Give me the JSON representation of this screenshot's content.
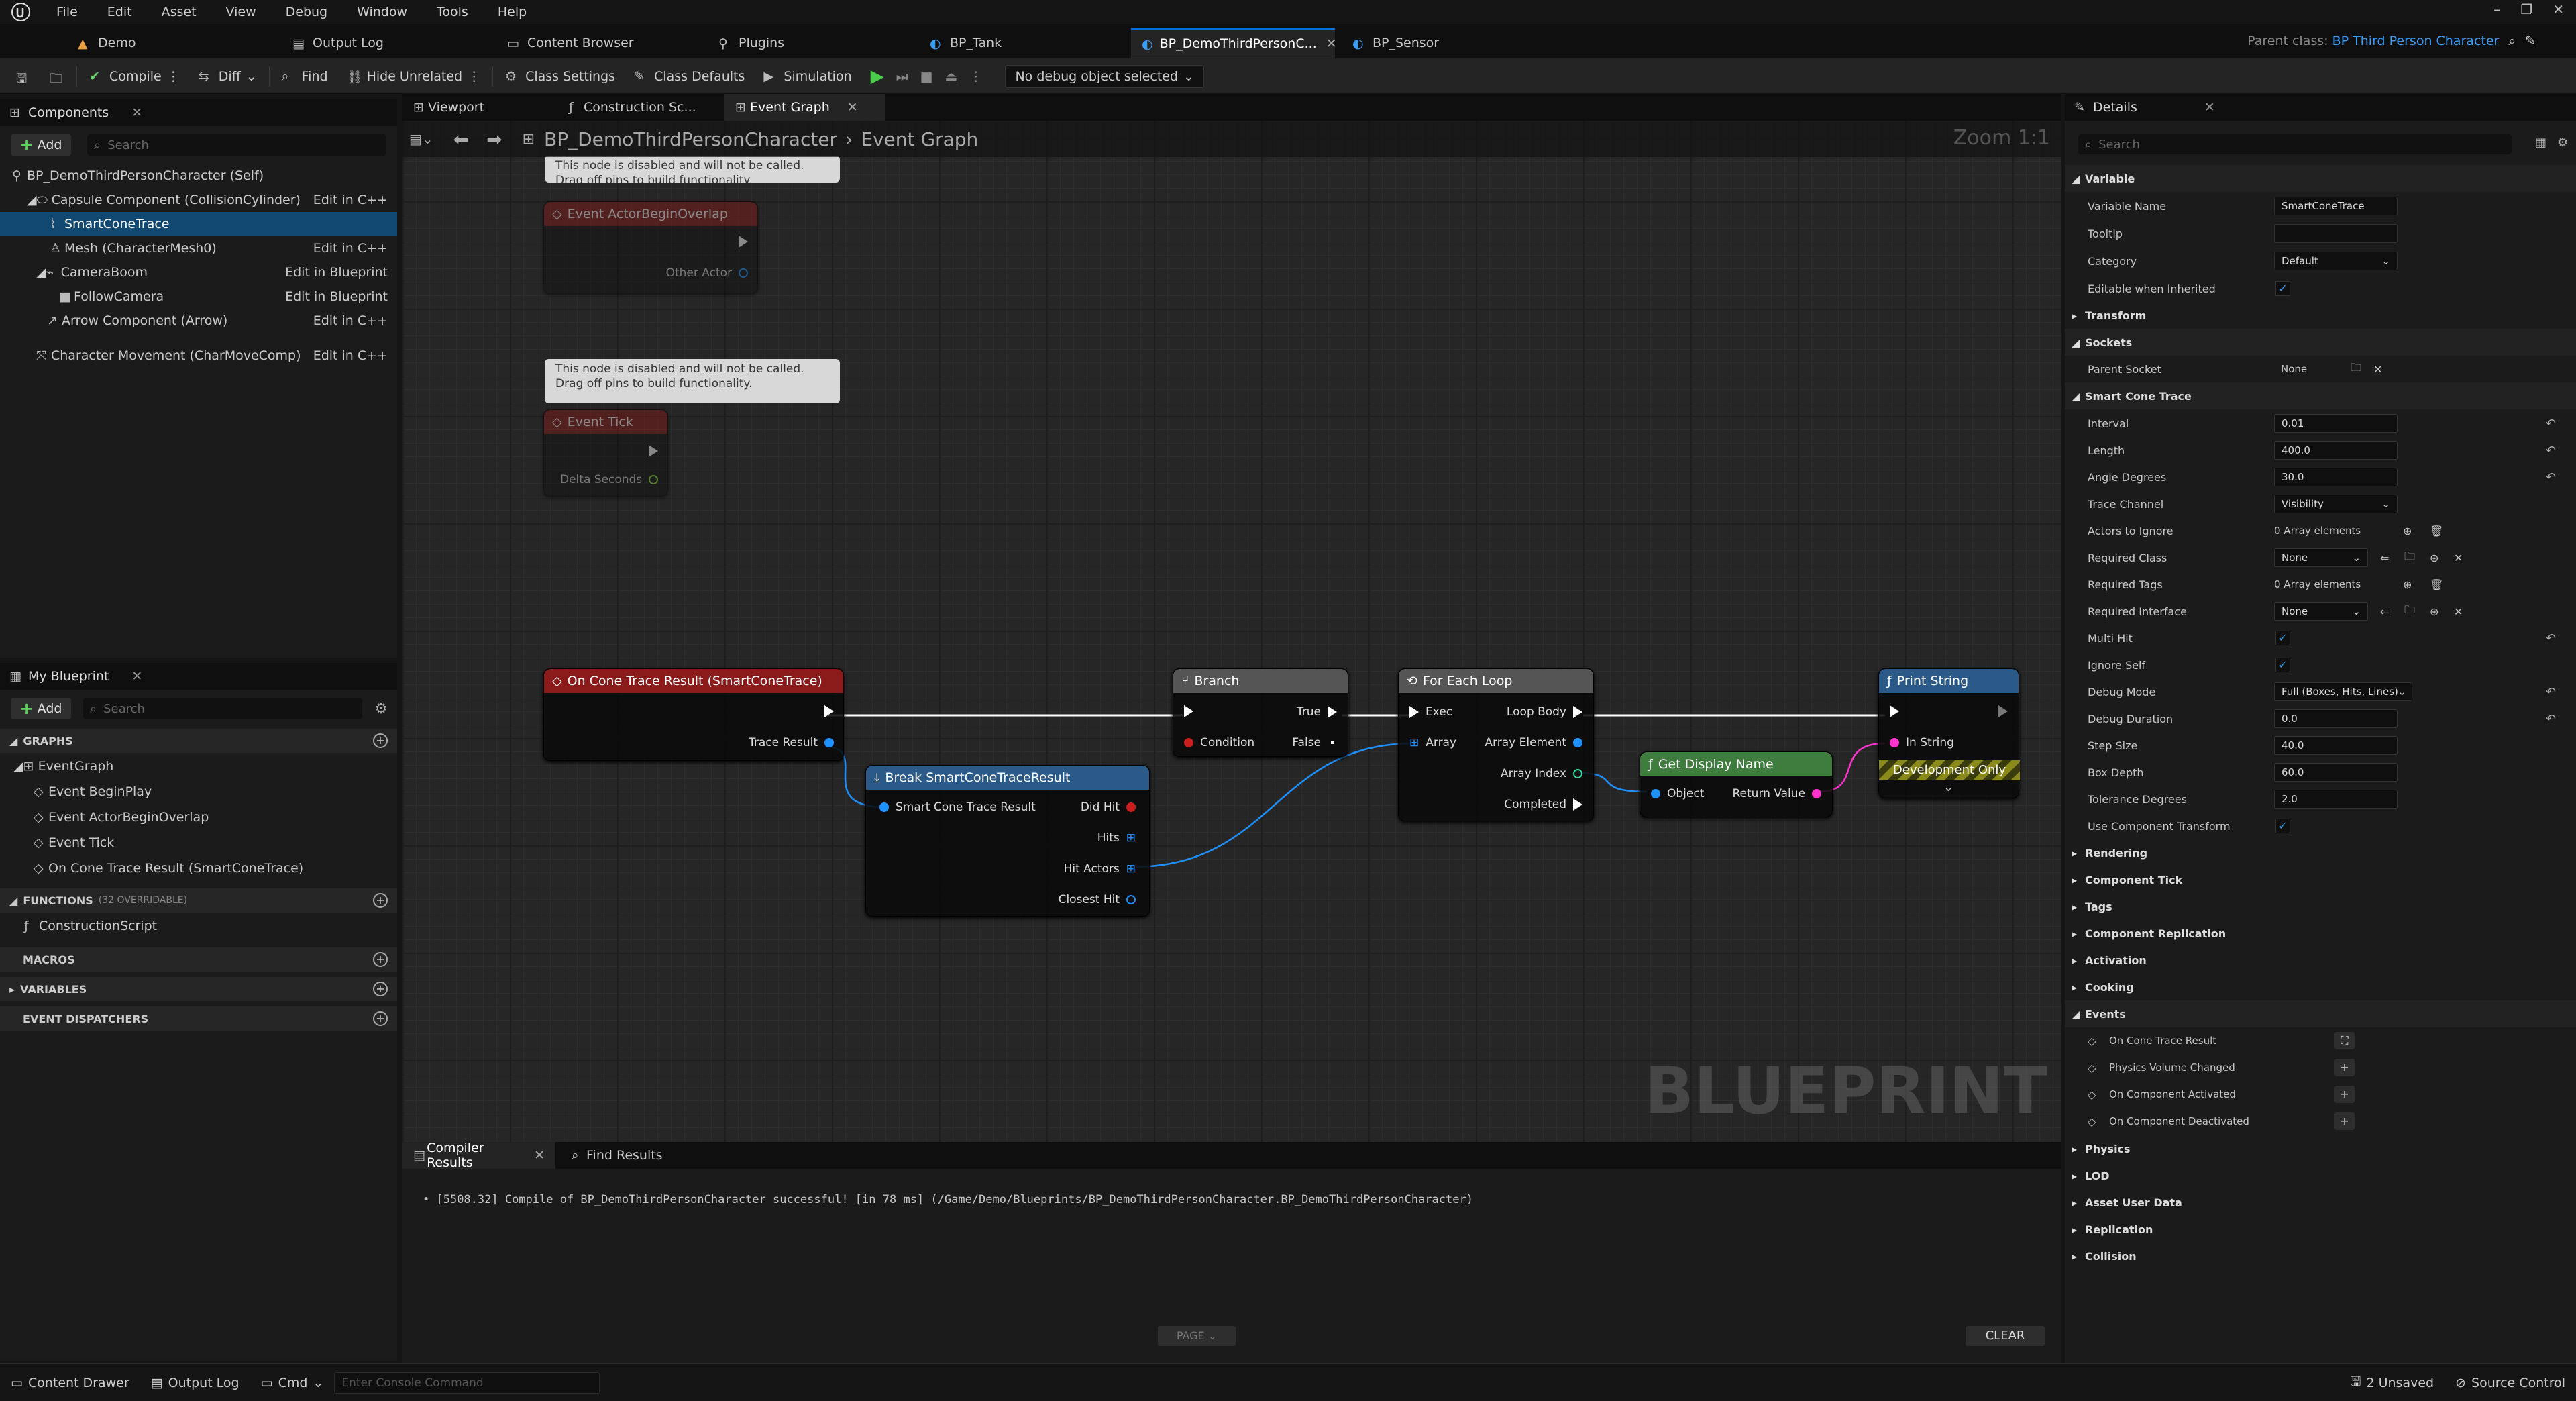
{
  "menubar": {
    "items": [
      "File",
      "Edit",
      "Asset",
      "View",
      "Debug",
      "Window",
      "Tools",
      "Help"
    ]
  },
  "tabs": {
    "items": [
      "Demo",
      "Output Log",
      "Content Browser",
      "Plugins",
      "BP_Tank",
      "BP_DemoThirdPersonC...",
      "BP_Sensor"
    ]
  },
  "parent_class": {
    "label": "Parent class:",
    "value": "BP Third Person Character"
  },
  "toolbar": {
    "compile": "Compile",
    "diff": "Diff",
    "find": "Find",
    "hide_unrelated": "Hide Unrelated",
    "class_settings": "Class Settings",
    "class_defaults": "Class Defaults",
    "simulation": "Simulation",
    "debug_object": "No debug object selected"
  },
  "components": {
    "tab": "Components",
    "add": "Add",
    "search_placeholder": "Search",
    "items": [
      {
        "label": "BP_DemoThirdPersonCharacter (Self)",
        "link": ""
      },
      {
        "label": "Capsule Component (CollisionCylinder)",
        "link": "Edit in C++"
      },
      {
        "label": "SmartConeTrace",
        "link": ""
      },
      {
        "label": "Mesh (CharacterMesh0)",
        "link": "Edit in C++"
      },
      {
        "label": "CameraBoom",
        "link": "Edit in Blueprint"
      },
      {
        "label": "FollowCamera",
        "link": "Edit in Blueprint"
      },
      {
        "label": "Arrow Component (Arrow)",
        "link": "Edit in C++"
      },
      {
        "label": "Character Movement (CharMoveComp)",
        "link": "Edit in C++"
      }
    ]
  },
  "my_blueprint": {
    "tab": "My Blueprint",
    "add": "Add",
    "search_placeholder": "Search",
    "graphs": "GRAPHS",
    "graph_items": [
      "EventGraph",
      "Event BeginPlay",
      "Event ActorBeginOverlap",
      "Event Tick",
      "On Cone Trace Result (SmartConeTrace)"
    ],
    "functions": "FUNCTIONS",
    "functions_count": "(32 OVERRIDABLE)",
    "function_items": [
      "ConstructionScript"
    ],
    "macros": "MACROS",
    "variables": "VARIABLES",
    "dispatchers": "EVENT DISPATCHERS"
  },
  "graph": {
    "tabs": [
      "Viewport",
      "Construction Sc...",
      "Event Graph"
    ],
    "breadcrumb_root": "BP_DemoThirdPersonCharacter",
    "breadcrumb_leaf": "Event Graph",
    "zoom": "Zoom 1:1",
    "watermark": "BLUEPRINT",
    "disabled_comment_1": "This node is disabled and will not be called.",
    "disabled_comment_2": "Drag off pins to build functionality.",
    "nodes": {
      "overlap": {
        "title": "Event ActorBeginOverlap",
        "pin": "Other Actor"
      },
      "tick": {
        "title": "Event Tick",
        "pin": "Delta Seconds"
      },
      "cone": {
        "title": "On Cone Trace Result (SmartConeTrace)",
        "pin": "Trace Result"
      },
      "break": {
        "title": "Break SmartConeTraceResult",
        "in": "Smart Cone Trace Result",
        "out": [
          "Did Hit",
          "Hits",
          "Hit Actors",
          "Closest Hit"
        ]
      },
      "branch": {
        "title": "Branch",
        "in": "Condition",
        "true": "True",
        "false": "False"
      },
      "foreach": {
        "title": "For Each Loop",
        "exec": "Exec",
        "array": "Array",
        "loop_body": "Loop Body",
        "element": "Array Element",
        "index": "Array Index",
        "completed": "Completed"
      },
      "display": {
        "title": "Get Display Name",
        "in": "Object",
        "out": "Return Value"
      },
      "print": {
        "title": "Print String",
        "in": "In String",
        "dev": "Development Only"
      }
    }
  },
  "compiler": {
    "tabs": [
      "Compiler Results",
      "Find Results"
    ],
    "message": "[5508.32] Compile of BP_DemoThirdPersonCharacter successful! [in 78 ms] (/Game/Demo/Blueprints/BP_DemoThirdPersonCharacter.BP_DemoThirdPersonCharacter)",
    "page": "PAGE",
    "clear": "CLEAR"
  },
  "details": {
    "tab": "Details",
    "search_placeholder": "Search",
    "variable": {
      "section": "Variable",
      "name_label": "Variable Name",
      "name": "SmartConeTrace",
      "tooltip_label": "Tooltip",
      "category_label": "Category",
      "category": "Default",
      "editable_label": "Editable when Inherited"
    },
    "transform": "Transform",
    "sockets": "Sockets",
    "parent_socket_label": "Parent Socket",
    "parent_socket": "None",
    "sct": {
      "section": "Smart Cone Trace",
      "rows": [
        {
          "label": "Interval",
          "value": "0.01"
        },
        {
          "label": "Length",
          "value": "400.0"
        },
        {
          "label": "Angle Degrees",
          "value": "30.0"
        },
        {
          "label": "Trace Channel",
          "value": "Visibility"
        },
        {
          "label": "Actors to Ignore",
          "value": "0 Array elements"
        },
        {
          "label": "Required Class",
          "value": "None"
        },
        {
          "label": "Required Tags",
          "value": "0 Array elements"
        },
        {
          "label": "Required Interface",
          "value": "None"
        },
        {
          "label": "Multi Hit",
          "value": ""
        },
        {
          "label": "Ignore Self",
          "value": ""
        },
        {
          "label": "Debug Mode",
          "value": "Full (Boxes, Hits, Lines)"
        },
        {
          "label": "Debug Duration",
          "value": "0.0"
        },
        {
          "label": "Step Size",
          "value": "40.0"
        },
        {
          "label": "Box Depth",
          "value": "60.0"
        },
        {
          "label": "Tolerance Degrees",
          "value": "2.0"
        },
        {
          "label": "Use Component Transform",
          "value": ""
        }
      ]
    },
    "sections_a": [
      "Rendering",
      "Component Tick",
      "Tags",
      "Component Replication",
      "Activation",
      "Cooking"
    ],
    "events": {
      "section": "Events",
      "items": [
        "On Cone Trace Result",
        "Physics Volume Changed",
        "On Component Activated",
        "On Component Deactivated"
      ]
    },
    "sections_b": [
      "Physics",
      "LOD",
      "Asset User Data",
      "Replication",
      "Collision"
    ]
  },
  "statusbar": {
    "content_drawer": "Content Drawer",
    "output_log": "Output Log",
    "cmd": "Cmd",
    "console_placeholder": "Enter Console Command",
    "unsaved": "2 Unsaved",
    "source_control": "Source Control"
  },
  "colors": {
    "accent": "#0070e0",
    "selection": "#104872",
    "event_header": "#8b1a1a",
    "pure_header": "#3f7d3f",
    "func_header": "#2c5a88",
    "exec_wire": "#ffffff",
    "object_wire": "#1e90ff",
    "string_wire": "#ff33cc"
  }
}
